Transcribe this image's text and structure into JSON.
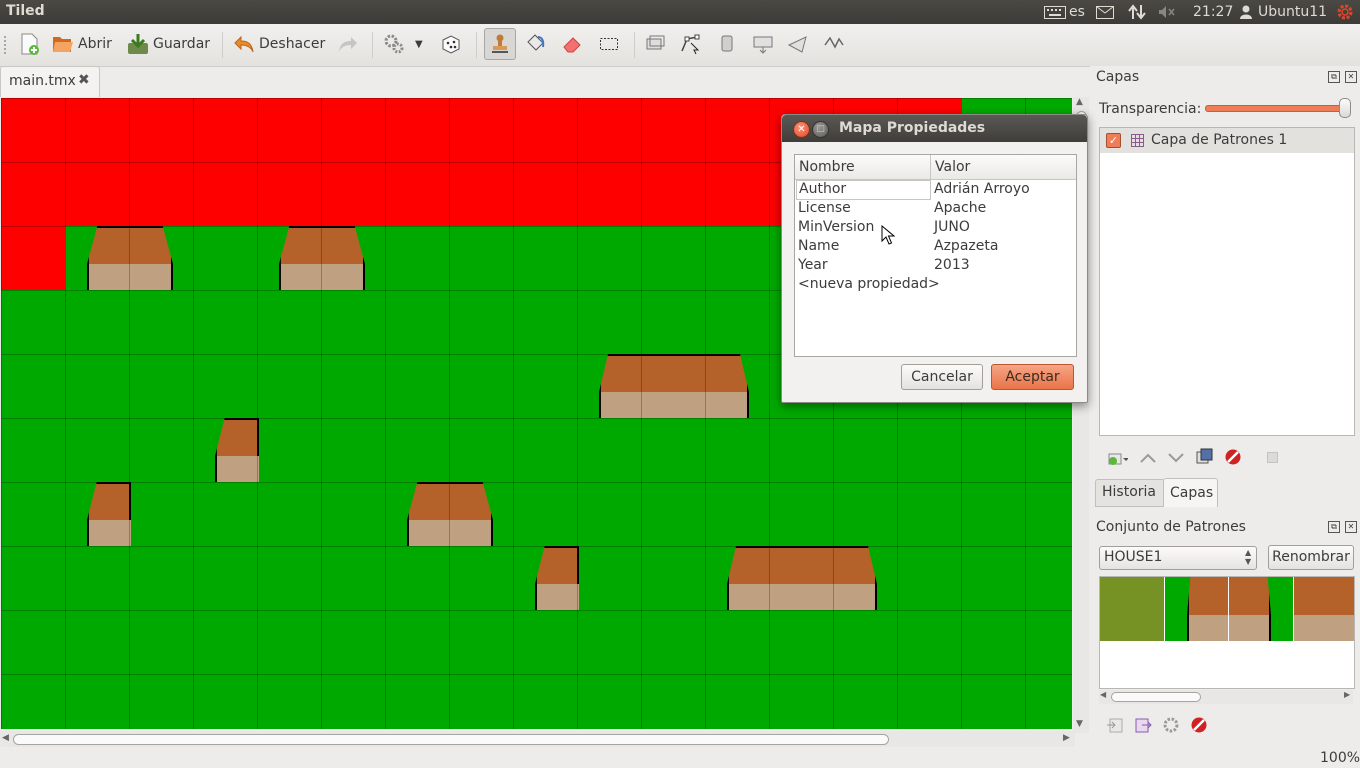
{
  "system_bar": {
    "app_title": "Tiled",
    "keyboard_layout": "es",
    "clock": "21:27",
    "user": "Ubuntu11"
  },
  "toolbar": {
    "open_label": "Abrir",
    "save_label": "Guardar",
    "undo_label": "Deshacer"
  },
  "tabs": [
    {
      "label": "main.tmx"
    }
  ],
  "dialog": {
    "title": "Mapa Propiedades",
    "col_name": "Nombre",
    "col_value": "Valor",
    "properties": [
      {
        "name": "Author",
        "value": "Adrián Arroyo"
      },
      {
        "name": "License",
        "value": "Apache"
      },
      {
        "name": "MinVersion",
        "value": "JUNO"
      },
      {
        "name": "Name",
        "value": "Azpazeta"
      },
      {
        "name": "Year",
        "value": "2013"
      }
    ],
    "new_property": "<nueva propiedad>",
    "cancel_label": "Cancelar",
    "accept_label": "Aceptar"
  },
  "layers_panel": {
    "title": "Capas",
    "opacity_label": "Transparencia:",
    "opacity_value": 1.0,
    "layers": [
      {
        "name": "Capa de Patrones 1",
        "visible": true
      }
    ]
  },
  "panel_tabs": {
    "history_label": "Historia",
    "layers_label": "Capas"
  },
  "tileset_panel": {
    "title": "Conjunto de Patrones",
    "selected_tileset": "HOUSE1",
    "rename_label": "Renombrar"
  },
  "status": {
    "zoom": "100%"
  },
  "colors": {
    "grass": "#00a900",
    "blocked": "#ff0000",
    "roof": "#b5622a",
    "wall": "#bfa080",
    "accent": "#ef7d58"
  }
}
